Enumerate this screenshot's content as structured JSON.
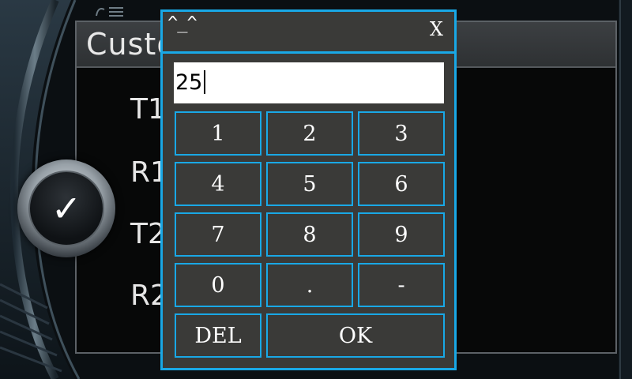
{
  "window": {
    "title": "Custom Setup",
    "settings": [
      {
        "label": "T1"
      },
      {
        "label": "R1"
      },
      {
        "label": "T2"
      },
      {
        "label": "R2"
      }
    ]
  },
  "confirm_button": {
    "icon": "checkmark-icon",
    "glyph": "✓"
  },
  "keypad_dialog": {
    "emote": "^_^",
    "close_label": "X",
    "display_value": "25",
    "keys": {
      "k1": "1",
      "k2": "2",
      "k3": "3",
      "k4": "4",
      "k5": "5",
      "k6": "6",
      "k7": "7",
      "k8": "8",
      "k9": "9",
      "k0": "0",
      "kdot": ".",
      "kminus": "-",
      "del": "DEL",
      "ok": "OK"
    },
    "accent_color": "#19a8e6",
    "panel_color": "#3a3a38"
  }
}
